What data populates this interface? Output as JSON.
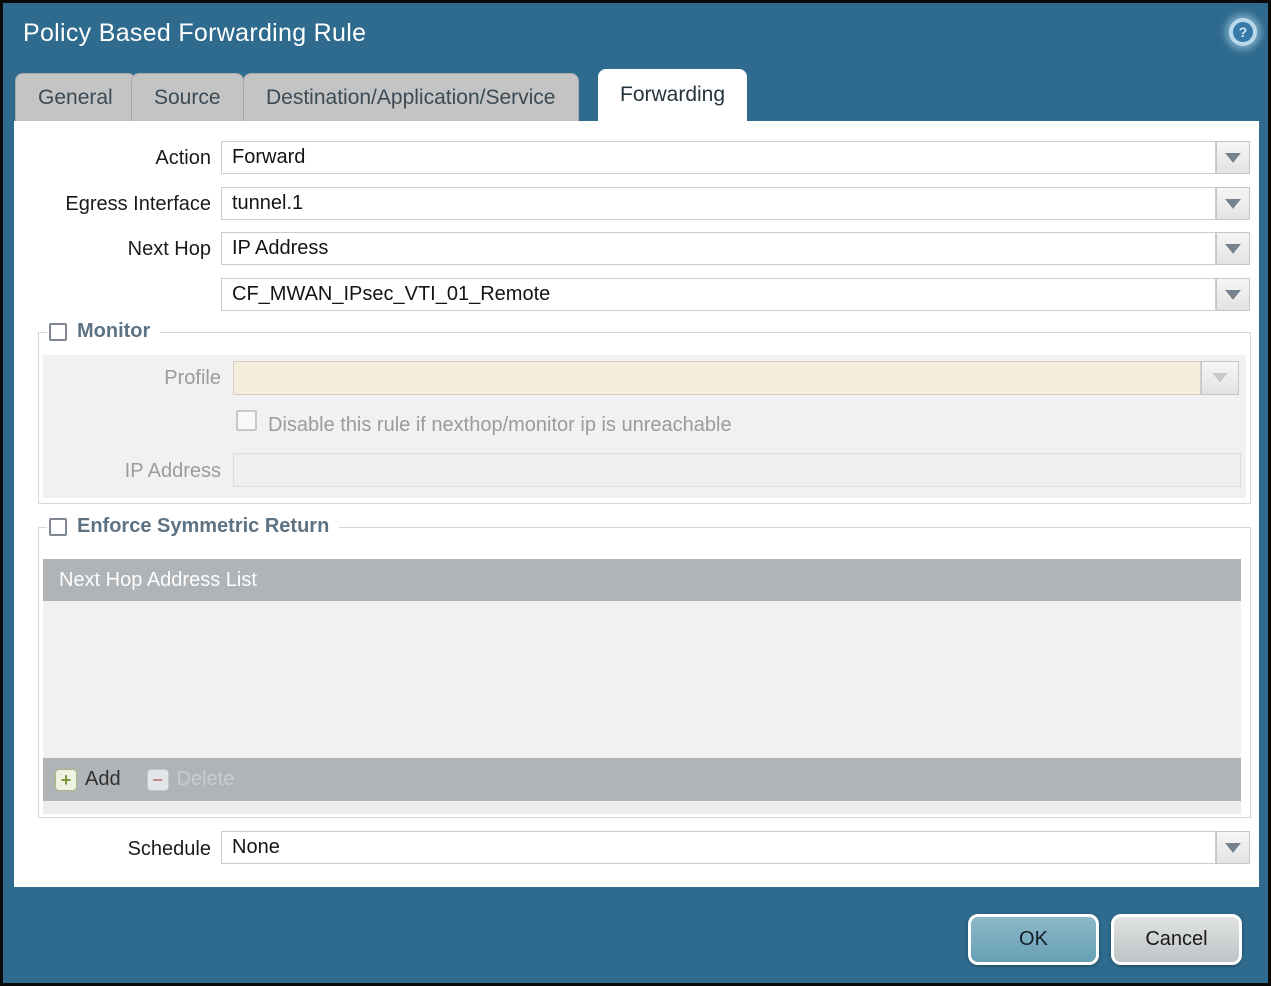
{
  "window": {
    "title": "Policy Based Forwarding Rule"
  },
  "icons": {
    "help_glyph": "?",
    "add_glyph": "+",
    "delete_glyph": "−"
  },
  "tabs": [
    {
      "label": "General",
      "active": false
    },
    {
      "label": "Source",
      "active": false
    },
    {
      "label": "Destination/Application/Service",
      "active": false
    },
    {
      "label": "Forwarding",
      "active": true
    }
  ],
  "form": {
    "action": {
      "label": "Action",
      "value": "Forward"
    },
    "egress_interface": {
      "label": "Egress Interface",
      "value": "tunnel.1"
    },
    "next_hop": {
      "label": "Next Hop",
      "value": "IP Address"
    },
    "next_hop_address": {
      "value": "CF_MWAN_IPsec_VTI_01_Remote"
    },
    "schedule": {
      "label": "Schedule",
      "value": "None"
    }
  },
  "monitor": {
    "legend": "Monitor",
    "checked": false,
    "profile": {
      "label": "Profile",
      "value": ""
    },
    "disable_rule": {
      "label": "Disable this rule if nexthop/monitor ip is unreachable",
      "checked": false
    },
    "ip_address": {
      "label": "IP Address",
      "value": ""
    }
  },
  "symmetric_return": {
    "legend": "Enforce Symmetric Return",
    "checked": false,
    "table": {
      "header": "Next Hop Address List",
      "rows": []
    },
    "add_label": "Add",
    "delete_label": "Delete",
    "delete_enabled": false
  },
  "footer": {
    "ok_label": "OK",
    "cancel_label": "Cancel"
  },
  "colors": {
    "titlebar": "#2e6b8e",
    "tab_inactive": "#c4c4c4",
    "tab_active": "#ffffff",
    "disabled_profile_field": "#f5eedd",
    "disabled_panel": "#f1f1f1",
    "table_header": "#b0b4b7",
    "ok_button": "#6fa3b8",
    "cancel_button": "#c4c8ca"
  }
}
